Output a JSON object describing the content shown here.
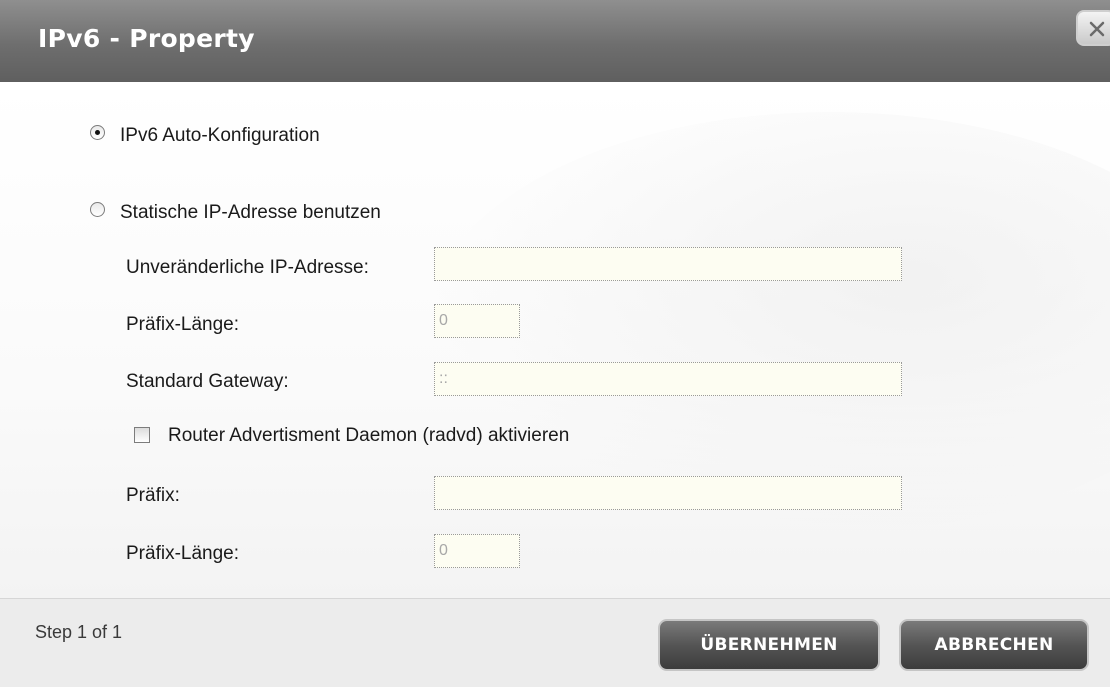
{
  "dialog": {
    "title": "IPv6 - Property",
    "close_label": "X"
  },
  "options": {
    "auto_config_label": "IPv6 Auto-Konfiguration",
    "auto_config_selected": true,
    "static_ip_label": "Statische IP-Adresse benutzen",
    "static_ip_selected": false
  },
  "static": {
    "fixed_ip_label": "Unveränderliche IP-Adresse:",
    "fixed_ip_value": "",
    "prefix_length_label": "Präfix-Länge:",
    "prefix_length_value": "0",
    "gateway_label": "Standard Gateway:",
    "gateway_value": "::"
  },
  "radvd": {
    "enable_label": "Router Advertisment Daemon (radvd) aktivieren",
    "enabled": false,
    "prefix_label": "Präfix:",
    "prefix_value": "",
    "prefix_length_label": "Präfix-Länge:",
    "prefix_length_value": "0"
  },
  "footer": {
    "step_text": "Step 1 of 1",
    "apply_label": "ÜBERNEHMEN",
    "cancel_label": "ABBRECHEN"
  }
}
